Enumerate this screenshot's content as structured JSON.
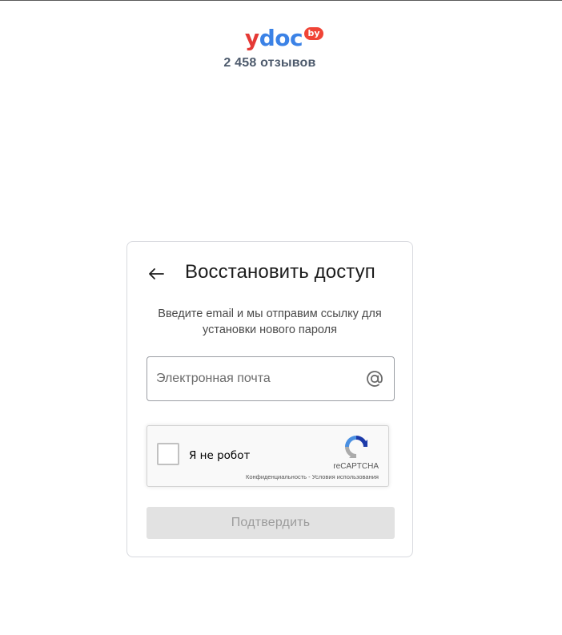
{
  "header": {
    "logo_y": "y",
    "logo_doc": "doc",
    "logo_badge": "by",
    "reviews": "2 458 отзывов"
  },
  "card": {
    "title": "Восстановить доступ",
    "description": "Введите email и мы отправим ссылку для установки нового пароля",
    "email": {
      "placeholder": "Электронная почта",
      "value": "",
      "icon": "at-icon"
    },
    "captcha": {
      "label": "Я не робот",
      "brand": "reCAPTCHA",
      "privacy": "Конфиденциальность",
      "separator": " - ",
      "terms": "Условия использования"
    },
    "submit_label": "Подтвердить"
  },
  "colors": {
    "logo_red": "#e53935",
    "logo_blue": "#3b82e6",
    "badge": "#f04436",
    "button_disabled_bg": "#e2e2e2",
    "button_disabled_text": "#9c9c9c"
  }
}
